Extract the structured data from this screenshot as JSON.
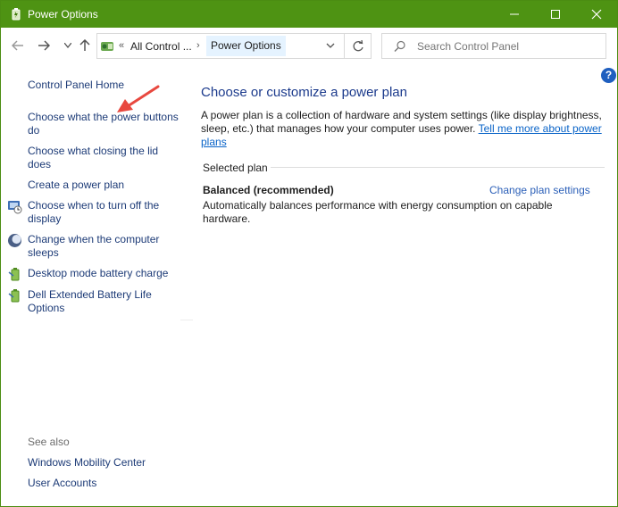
{
  "window": {
    "title": "Power Options"
  },
  "titlebar": {
    "minimize": "—",
    "maximize": "□",
    "close": "✕"
  },
  "address": {
    "chevron": "«",
    "segments": [
      "All Control ...",
      "Power Options"
    ],
    "separator": "›"
  },
  "search": {
    "placeholder": "Search Control Panel"
  },
  "help": {
    "label": "?"
  },
  "left_pane": {
    "home": "Control Panel Home",
    "links": [
      "Choose what the power buttons do",
      "Choose what closing the lid does",
      "Create a power plan",
      "Choose when to turn off the display",
      "Change when the computer sleeps",
      "Desktop mode battery charge",
      "Dell Extended Battery Life Options"
    ],
    "see_also": "See also",
    "see_also_links": [
      "Windows Mobility Center",
      "User Accounts"
    ]
  },
  "main": {
    "heading": "Choose or customize a power plan",
    "description": "A power plan is a collection of hardware and system settings (like display brightness, sleep, etc.) that manages how your computer uses power. ",
    "description_link": "Tell me more about power plans",
    "selected_plan_label": "Selected plan",
    "plan": {
      "name": "Balanced (recommended)",
      "change_link": "Change plan settings",
      "description": "Automatically balances performance with energy consumption on capable hardware."
    }
  },
  "colors": {
    "titlebar": "#4e9313",
    "link": "#1d3b77",
    "heading": "#1b3a8c",
    "annotation_arrow": "#e8483f"
  }
}
